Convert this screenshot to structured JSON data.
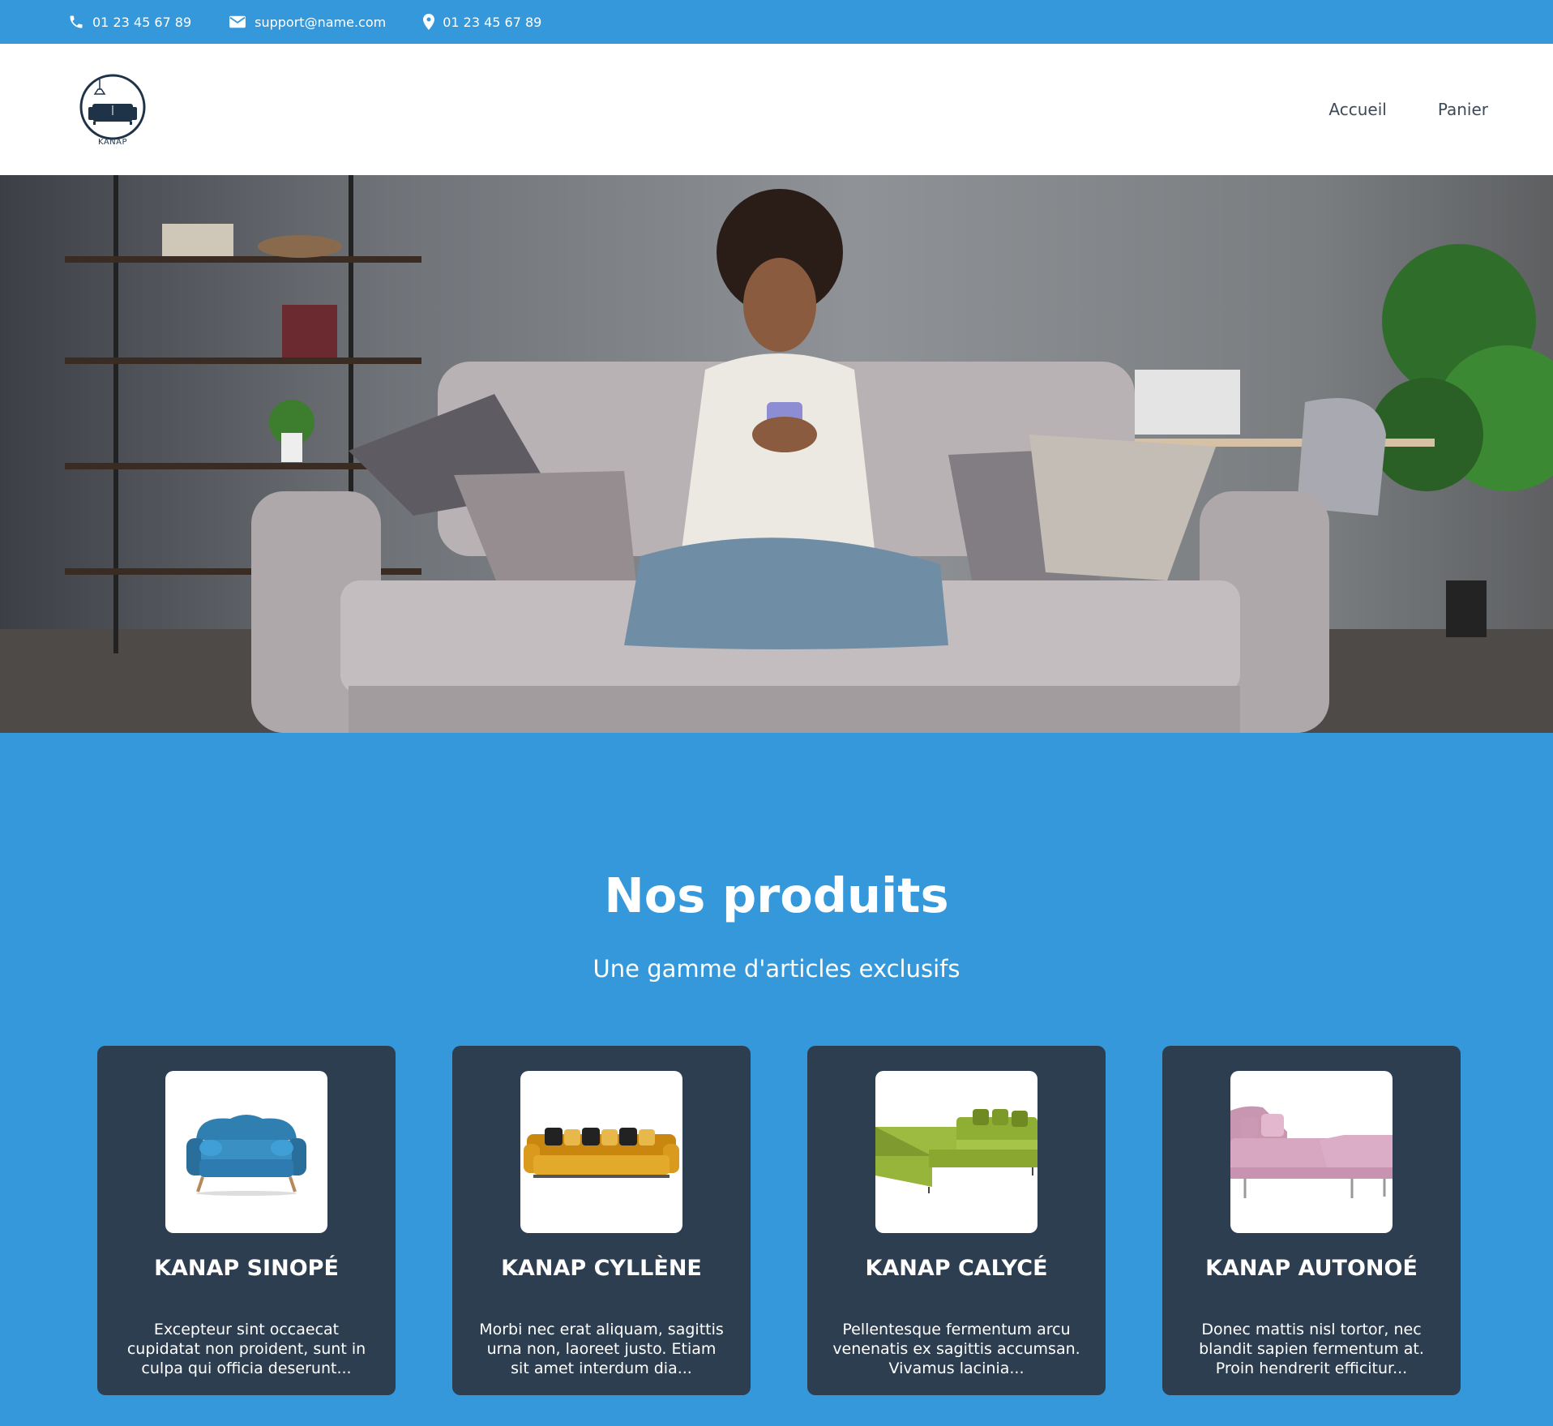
{
  "topbar": {
    "phone": "01 23 45 67 89",
    "email": "support@name.com",
    "location": "01 23 45 67 89"
  },
  "header": {
    "logo_text": "KANAP",
    "nav": [
      {
        "label": "Accueil"
      },
      {
        "label": "Panier"
      }
    ]
  },
  "products": {
    "title": "Nos produits",
    "subtitle": "Une gamme d'articles exclusifs",
    "items": [
      {
        "name": "KANAP SINOPÉ",
        "description": "Excepteur sint occaecat cupidatat non proident, sunt in culpa qui officia deserunt...",
        "color": "#2f7fb0"
      },
      {
        "name": "KANAP CYLLÈNE",
        "description": "Morbi nec erat aliquam, sagittis urna non, laoreet justo. Etiam sit amet interdum dia...",
        "color": "#d99a1e"
      },
      {
        "name": "KANAP CALYCÉ",
        "description": "Pellentesque fermentum arcu venenatis ex sagittis accumsan. Vivamus lacinia...",
        "color": "#8faa35"
      },
      {
        "name": "KANAP AUTONOÉ",
        "description": "Donec mattis nisl tortor, nec blandit sapien fermentum at. Proin hendrerit efficitur...",
        "color": "#d7a6c0"
      }
    ]
  },
  "colors": {
    "brand_blue": "#3498db",
    "card_bg": "#2c3e50"
  }
}
